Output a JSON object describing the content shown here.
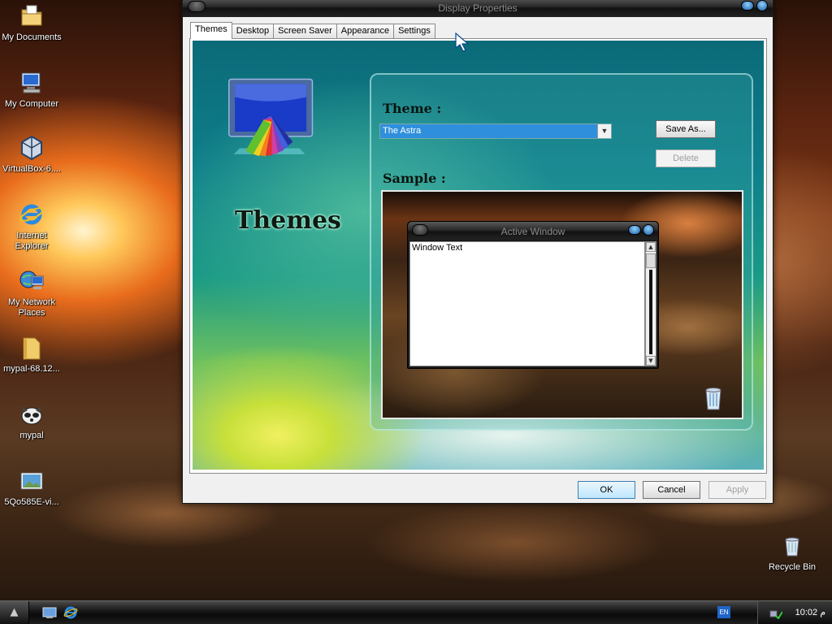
{
  "desktop": {
    "icons": [
      {
        "label": "My Documents"
      },
      {
        "label": "My Computer"
      },
      {
        "label": "VirtualBox-6...."
      },
      {
        "label": "Internet Explorer"
      },
      {
        "label": "My Network Places"
      },
      {
        "label": "mypal-68.12..."
      },
      {
        "label": "mypal"
      },
      {
        "label": "5Qo585E-vi..."
      },
      {
        "label": "Recycle Bin"
      }
    ]
  },
  "window": {
    "title": "Display Properties",
    "tabs": [
      {
        "label": "Themes"
      },
      {
        "label": "Desktop"
      },
      {
        "label": "Screen Saver"
      },
      {
        "label": "Appearance"
      },
      {
        "label": "Settings"
      }
    ],
    "themes_heading": "Themes",
    "theme_label": "Theme :",
    "theme_value": "The Astra",
    "save_as_label": "Save As...",
    "delete_label": "Delete",
    "sample_label": "Sample :",
    "sample": {
      "window_title": "Active Window",
      "window_text": "Window Text"
    },
    "ok_label": "OK",
    "cancel_label": "Cancel",
    "apply_label": "Apply"
  },
  "taskbar": {
    "start_glyph": "▲",
    "language": "EN",
    "clock": "10:02 م"
  },
  "colors": {
    "selection_blue": "#2f8fdc",
    "titlebar_dark": "#1a1a1a",
    "orb_blue": "#1a5aa0"
  }
}
